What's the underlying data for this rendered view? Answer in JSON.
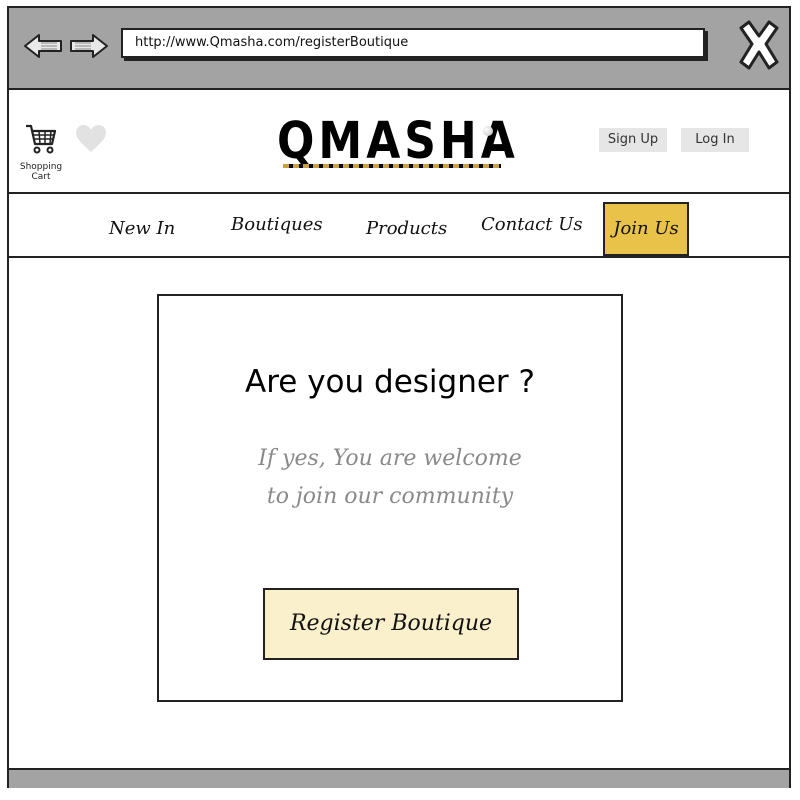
{
  "browser": {
    "url": "http://www.Qmasha.com/registerBoutique",
    "back_icon": "back-arrow-icon",
    "forward_icon": "forward-arrow-icon",
    "close_icon": "close-x-icon"
  },
  "header": {
    "cart_label": "Shopping Cart",
    "cart_icon": "shopping-cart-icon",
    "wishlist_icon": "heart-icon",
    "logo_text": "QMASHA",
    "signup_label": "Sign Up",
    "login_label": "Log In"
  },
  "nav": {
    "items": [
      {
        "label": "New In"
      },
      {
        "label": "Boutiques"
      },
      {
        "label": "Products"
      },
      {
        "label": "Contact Us"
      }
    ],
    "join_label": "Join Us"
  },
  "main": {
    "title": "Are you designer ?",
    "line1": "If yes, You are welcome",
    "line2": "to join our community",
    "register_label": "Register Boutique"
  },
  "colors": {
    "chrome_gray": "#a3a3a3",
    "join_highlight": "#e9c24a",
    "register_fill": "#fbf0cc",
    "muted_text": "#8a8a8a"
  }
}
